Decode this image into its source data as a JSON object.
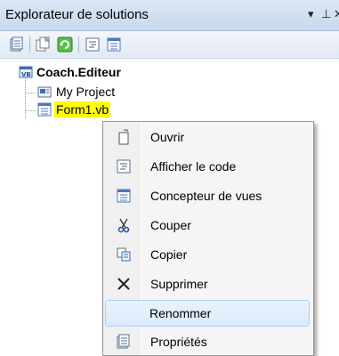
{
  "panel": {
    "title": "Explorateur de solutions",
    "dropdown_glyph": "▾",
    "pin_glyph": "⊥",
    "close_glyph": "✕"
  },
  "toolbar": {
    "buttons": [
      {
        "icon": "properties-icon"
      },
      {
        "icon": "show-all-files-icon"
      },
      {
        "icon": "refresh-icon"
      },
      {
        "icon": "view-code-icon"
      },
      {
        "icon": "view-designer-icon"
      }
    ]
  },
  "tree": {
    "project": {
      "label": "Coach.Editeur",
      "icon": "vb-project-icon"
    },
    "children": [
      {
        "label": "My Project",
        "icon": "my-project-icon"
      },
      {
        "label": "Form1.vb",
        "icon": "form-icon",
        "highlight_color": "#ffff00"
      }
    ]
  },
  "context_menu": {
    "items": [
      {
        "label": "Ouvrir",
        "icon": "open-icon"
      },
      {
        "label": "Afficher le code",
        "icon": "view-code-icon"
      },
      {
        "label": "Concepteur de vues",
        "icon": "view-designer-icon"
      },
      {
        "label": "Couper",
        "icon": "scissors-icon"
      },
      {
        "label": "Copier",
        "icon": "copy-icon"
      },
      {
        "label": "Supprimer",
        "icon": "delete-x-icon"
      },
      {
        "label": "Renommer",
        "icon": "",
        "hovered": true
      },
      {
        "label": "Propriétés",
        "icon": "properties-icon"
      }
    ]
  }
}
